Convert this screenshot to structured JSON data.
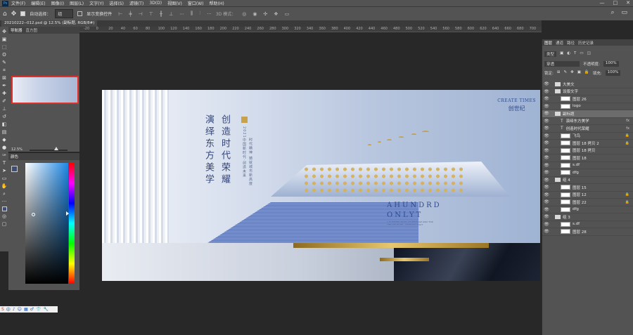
{
  "menubar": {
    "items": [
      "文件(F)",
      "编辑(E)",
      "图像(I)",
      "图层(L)",
      "文字(Y)",
      "选择(S)",
      "滤镜(T)",
      "3D(D)",
      "视图(V)",
      "窗口(W)",
      "帮助(H)"
    ]
  },
  "options": {
    "auto_select_label": "自动选择：",
    "auto_select_value": "组",
    "show_transform_label": "显示变换控件",
    "mode_3d": "3D 模式："
  },
  "document": {
    "tab_title": "20210222--012.psd @ 12.5% (副标题, RGB/8#)"
  },
  "ruler": {
    "ticks": [
      "-20",
      "0",
      "20",
      "40",
      "60",
      "80",
      "100",
      "120",
      "140",
      "160",
      "180",
      "200",
      "220",
      "240",
      "260",
      "280",
      "300",
      "320",
      "340",
      "360",
      "380",
      "400",
      "420",
      "440",
      "460",
      "480",
      "500",
      "520",
      "540",
      "560",
      "580",
      "600",
      "620",
      "640",
      "660",
      "680",
      "700"
    ]
  },
  "navigator": {
    "tabs": [
      "导航器",
      "直方图"
    ],
    "zoom": "12.5%"
  },
  "color_panel": {
    "title": "颜色",
    "foreground": "#3c4d7a"
  },
  "artwork": {
    "vcol1": "演绎东方美学",
    "vcol2": "创造时代荣耀",
    "vsmall1": "2021中国新时代·创造未来",
    "vsmall2": "时代精神 铸就城市新高度",
    "brand_en": "CREATE TIMES",
    "brand_cn": "创世纪",
    "en_title_1": "AHUNDRD",
    "en_title_2": "ONLYT",
    "en_sub": "A HUNDRED YEARS OF HERITAGE ONLY FOR THE CITY ELITE · AHUNDRD ONLYT"
  },
  "layers": {
    "tabs": [
      "图层",
      "通道",
      "路径",
      "历史记录"
    ],
    "kind_label": "类型",
    "blend_mode": "穿透",
    "opacity_label": "不透明度:",
    "opacity": "100%",
    "lock_label": "锁定:",
    "fill_label": "填充:",
    "fill": "100%",
    "items": [
      {
        "name": "大美文",
        "kind": "folder",
        "selected": false
      },
      {
        "name": "设版文字",
        "kind": "folder",
        "selected": false
      },
      {
        "name": "图层 26",
        "kind": "layer",
        "selected": false
      },
      {
        "name": "logo",
        "kind": "layer",
        "selected": false
      },
      {
        "name": "副标题",
        "kind": "folder",
        "selected": true
      },
      {
        "name": "演绎东方美学",
        "kind": "text",
        "fx": "fx",
        "selected": false
      },
      {
        "name": "创造时代荣耀",
        "kind": "text",
        "fx": "fx",
        "selected": false
      },
      {
        "name": "飞鸟",
        "kind": "layer",
        "lock": "🔒",
        "selected": false
      },
      {
        "name": "图层 18 拷贝 2",
        "kind": "layer",
        "lock": "🔒",
        "selected": false
      },
      {
        "name": "图层 18 拷贝",
        "kind": "layer",
        "selected": false
      },
      {
        "name": "图层 18",
        "kind": "layer",
        "selected": false
      },
      {
        "name": "s.df",
        "kind": "layer",
        "selected": false
      },
      {
        "name": "dfg",
        "kind": "layer",
        "selected": false
      },
      {
        "name": "组 4",
        "kind": "folder",
        "selected": false
      },
      {
        "name": "图层 15",
        "kind": "layer",
        "selected": false
      },
      {
        "name": "图层 12",
        "kind": "layer",
        "lock": "🔒",
        "selected": false
      },
      {
        "name": "图层 22",
        "kind": "layer",
        "lock": "🔒",
        "selected": false
      },
      {
        "name": "dfg",
        "kind": "layer",
        "selected": false
      },
      {
        "name": "组 3",
        "kind": "folder",
        "selected": false
      },
      {
        "name": "s.df",
        "kind": "layer",
        "selected": false
      },
      {
        "name": "图层 28",
        "kind": "layer",
        "selected": false
      }
    ]
  },
  "ime_bar": {
    "items": [
      "S",
      "中",
      "♪",
      "☺",
      "▦",
      "♂",
      "👕",
      "🔧"
    ]
  }
}
